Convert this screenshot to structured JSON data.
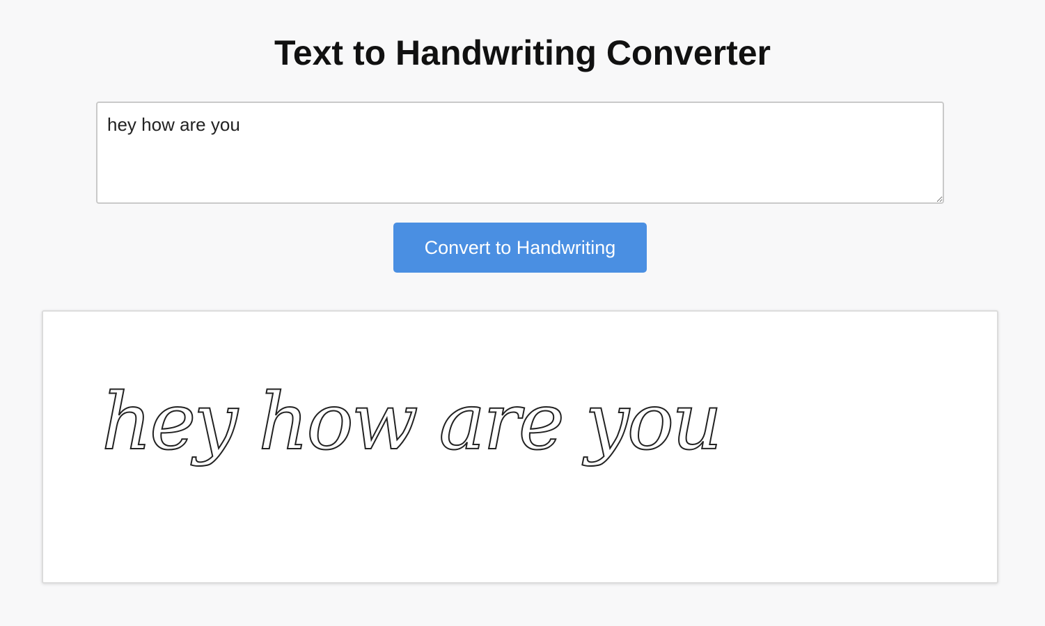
{
  "app": {
    "title": "Text to Handwriting Converter"
  },
  "input": {
    "value": "hey how are you"
  },
  "actions": {
    "convert_label": "Convert to Handwriting"
  },
  "output": {
    "handwriting_text": "hey how are you"
  },
  "colors": {
    "background": "#f8f8f9",
    "button": "#4a8fe2",
    "button_text": "#ffffff",
    "panel": "#ffffff"
  }
}
